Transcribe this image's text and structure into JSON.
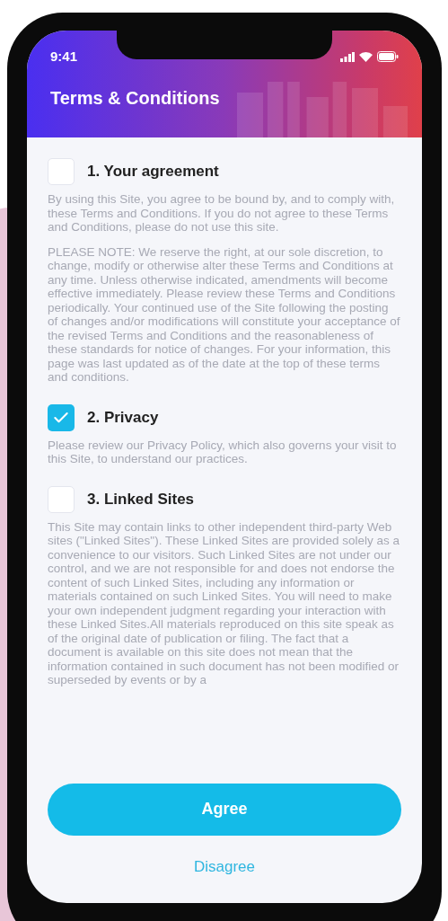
{
  "status_bar": {
    "time": "9:41"
  },
  "header": {
    "title": "Terms & Conditions"
  },
  "sections": [
    {
      "title": "1. Your agreement",
      "checked": false,
      "paragraphs": [
        "By using this Site, you agree to be bound by, and to comply with, these Terms and Conditions. If you do not agree to these Terms and Conditions, please do not use this site.",
        "PLEASE NOTE: We reserve the right, at our sole discretion, to change, modify or otherwise alter these Terms and Conditions at any time. Unless otherwise indicated, amendments will become effective immediately. Please review these Terms and Conditions periodically. Your continued use of the Site following the posting of changes and/or modifications will constitute your acceptance of the revised Terms and Conditions and the reasonableness of these standards for notice of changes. For your information, this page was last updated as of the date at the top of these terms and conditions."
      ]
    },
    {
      "title": "2. Privacy",
      "checked": true,
      "paragraphs": [
        "Please review our Privacy Policy, which also governs your visit to this Site, to understand our practices."
      ]
    },
    {
      "title": "3. Linked Sites",
      "checked": false,
      "paragraphs": [
        "This Site may contain links to other independent third-party Web sites (\"Linked Sites\"). These Linked Sites are provided solely as a convenience to our visitors. Such Linked Sites are not under our control, and we are not responsible for and does not endorse the content of such Linked Sites, including any information or materials contained on such Linked Sites. You will need to make your own independent judgment regarding your interaction with these Linked Sites.All materials reproduced on this site speak as of the original date of publication or filing. The fact that a document is available on this site does not mean that the information contained in such document has not been modified or superseded by events or by a"
      ]
    }
  ],
  "buttons": {
    "primary": "Agree",
    "secondary": "Disagree"
  }
}
